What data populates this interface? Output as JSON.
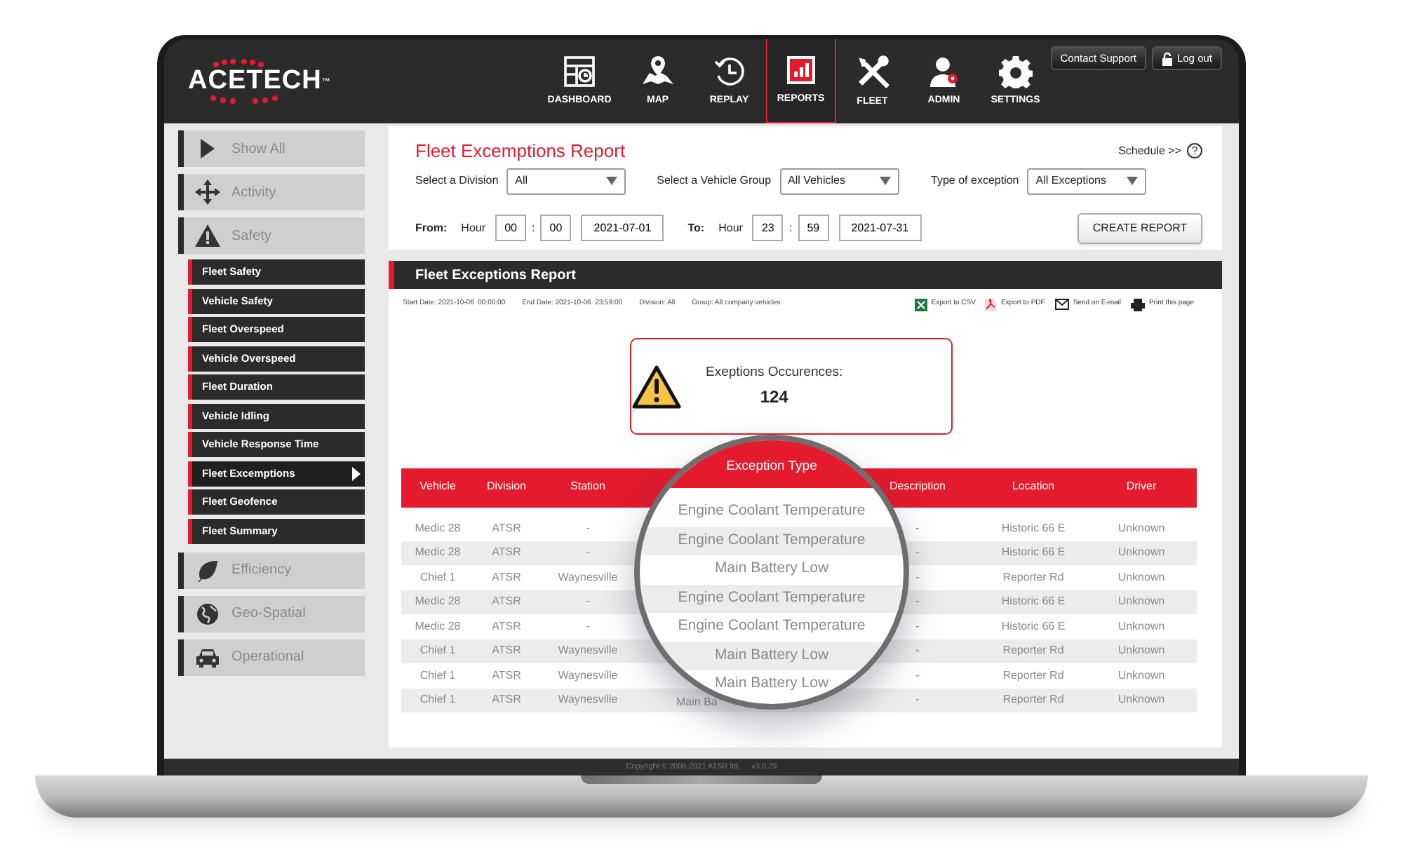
{
  "header": {
    "logo": "ACETECH",
    "logo_mark": "™",
    "nav": [
      {
        "label": "DASHBOARD",
        "selected": false
      },
      {
        "label": "MAP",
        "selected": false
      },
      {
        "label": "REPLAY",
        "selected": false
      },
      {
        "label": "REPORTS",
        "selected": true
      },
      {
        "label": "FLEET",
        "selected": false
      },
      {
        "label": "ADMIN",
        "selected": false
      },
      {
        "label": "SETTINGS",
        "selected": false
      }
    ],
    "buttons": [
      "Contact Support",
      "Log out"
    ]
  },
  "sidebar": {
    "items": [
      {
        "label": "Show All"
      },
      {
        "label": "Activity"
      },
      {
        "label": "Safety",
        "children": [
          {
            "label": "Fleet Safety",
            "selected": false
          },
          {
            "label": "Vehicle Safety",
            "selected": false
          },
          {
            "label": "Fleet Overspeed",
            "selected": false
          },
          {
            "label": "Vehicle Overspeed",
            "selected": false
          },
          {
            "label": "Fleet Duration",
            "selected": false
          },
          {
            "label": "Vehicle Idling",
            "selected": false
          },
          {
            "label": "Vehicle Response Time",
            "selected": false
          },
          {
            "label": "Fleet Excemptions",
            "selected": true
          },
          {
            "label": "Fleet Geofence",
            "selected": false
          },
          {
            "label": "Fleet Summary",
            "selected": false
          }
        ]
      },
      {
        "label": "Efficiency"
      },
      {
        "label": "Geo-Spatial"
      },
      {
        "label": "Operational"
      }
    ]
  },
  "filters": {
    "title": "Fleet Excemptions Report",
    "schedule": "Schedule >>",
    "help": "?",
    "fields": [
      {
        "label": "Select a Division",
        "value": "All"
      },
      {
        "label": "Select a Vehicle Group",
        "value": "All Vehicles"
      },
      {
        "label": "Type of exception",
        "value": "All Exceptions"
      }
    ],
    "ranges": [
      {
        "label": "From:",
        "hour_label": "Hour",
        "hour": "00",
        "separator": ":",
        "minute": "00",
        "date": "2021-07-01"
      },
      {
        "label": "To:",
        "hour_label": "Hour",
        "hour": "23",
        "separator": ":",
        "minute": "59",
        "date": "2021-07-31"
      }
    ],
    "create_button": "CREATE REPORT"
  },
  "report": {
    "title": "Fleet Exceptions Report",
    "info": [
      "Start Date: 2021-10-06  00:00:00",
      "End Date: 2021-10-06  23:59:00",
      "Division: All",
      "Group: All company vehicles"
    ],
    "exports": [
      "Export to CSV",
      "Export to PDF",
      "Send on E-mail",
      "Print this page"
    ],
    "alert": {
      "label": "Exeptions Occurences:",
      "count": "124"
    },
    "table": {
      "columns": [
        "Vehicle",
        "Division",
        "Station",
        "Description",
        "Location",
        "Driver"
      ],
      "rows": [
        {
          "vehicle": "Medic 28",
          "division": "ATSR",
          "station": "-",
          "description": "-",
          "location": "Historic 66 E",
          "driver": "Unknown"
        },
        {
          "vehicle": "Medic 28",
          "division": "ATSR",
          "station": "-",
          "description": "-",
          "location": "Historic 66 E",
          "driver": "Unknown"
        },
        {
          "vehicle": "Chief 1",
          "division": "ATSR",
          "station": "Waynesville",
          "description": "-",
          "location": "Reporter Rd",
          "driver": "Unknown"
        },
        {
          "vehicle": "Medic 28",
          "division": "ATSR",
          "station": "-",
          "description": "-",
          "location": "Historic 66 E",
          "driver": "Unknown"
        },
        {
          "vehicle": "Medic 28",
          "division": "ATSR",
          "station": "-",
          "description": "-",
          "location": "Historic 66 E",
          "driver": "Unknown"
        },
        {
          "vehicle": "Chief 1",
          "division": "ATSR",
          "station": "Waynesville",
          "description": "-",
          "location": "Reporter Rd",
          "driver": "Unknown"
        },
        {
          "vehicle": "Chief 1",
          "division": "ATSR",
          "station": "Waynesville",
          "description": "-",
          "location": "Reporter Rd",
          "driver": "Unknown"
        },
        {
          "vehicle": "Chief 1",
          "division": "ATSR",
          "station": "Waynesville",
          "exception_type": "Main Ba",
          "description": "-",
          "location": "Reporter Rd",
          "driver": "Unknown"
        }
      ]
    },
    "magnifier": {
      "header": "Exception Type",
      "values": [
        "Engine Coolant Temperature",
        "Engine Coolant Temperature",
        "Main Battery Low",
        "Engine Coolant Temperature",
        "Engine Coolant Temperature",
        "Main Battery Low",
        "Main Battery Low"
      ]
    }
  },
  "footer": {
    "copyright": "Copyright © 2008-2021 ATSR ltd.",
    "version": "v3.0.29"
  }
}
